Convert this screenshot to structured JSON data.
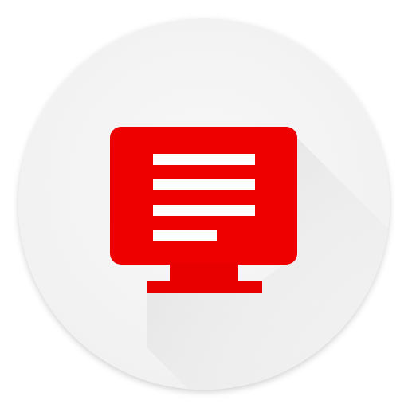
{
  "icon": {
    "name": "monitor-with-text-lines-icon",
    "background_color": "#f5f5f5",
    "monitor_color": "#ee0000",
    "text_line_color": "#ffffff",
    "shadow_color": "#d9d9d9"
  }
}
